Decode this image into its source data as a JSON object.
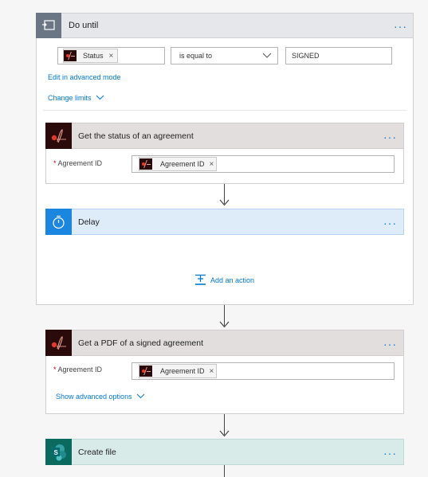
{
  "until": {
    "title": "Do until",
    "more": "···",
    "condition_token": "Status",
    "token_remove": "×",
    "operator": "is equal to",
    "value": "SIGNED",
    "advanced_link": "Edit in advanced mode",
    "limits_link": "Change limits"
  },
  "actions": {
    "status": {
      "title": "Get the status of an agreement",
      "field_label": "Agreement ID",
      "required_mark": "*",
      "token": "Agreement ID"
    },
    "delay": {
      "title": "Delay"
    },
    "add_action": "Add an action",
    "pdf": {
      "title": "Get a PDF of a signed agreement",
      "field_label": "Agreement ID",
      "required_mark": "*",
      "token": "Agreement ID",
      "advanced_link": "Show advanced options"
    },
    "create": {
      "title": "Create file"
    }
  },
  "colors": {
    "accent": "#0078d4",
    "adobe_bg": "#2a0a0a",
    "delay_blue": "#1a86e0",
    "sharepoint": "#0b6a5e"
  },
  "icons": [
    "loop-icon",
    "adobe-sign-icon",
    "timer-icon",
    "add-action-icon",
    "sharepoint-icon",
    "chevron-down-icon",
    "more-icon"
  ]
}
